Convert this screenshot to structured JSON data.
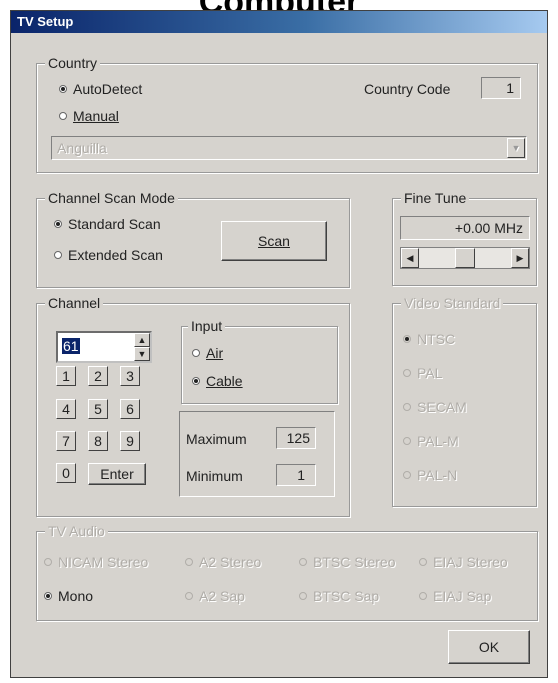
{
  "window": {
    "title": "TV Setup"
  },
  "country": {
    "group_label": "Country",
    "auto_detect_label": "AutoDetect",
    "manual_label": "Manual",
    "country_code_label": "Country Code",
    "country_code_value": "1",
    "selected_country": "Anguilla"
  },
  "scan_mode": {
    "group_label": "Channel Scan Mode",
    "standard_label": "Standard Scan",
    "extended_label": "Extended Scan",
    "scan_button": "Scan"
  },
  "fine_tune": {
    "group_label": "Fine Tune",
    "value": "+0.00 MHz",
    "slider_level": 0.5
  },
  "channel": {
    "group_label": "Channel",
    "current_value": "61",
    "keypad": [
      "1",
      "2",
      "3",
      "4",
      "5",
      "6",
      "7",
      "8",
      "9",
      "0"
    ],
    "enter_label": "Enter",
    "input_group_label": "Input",
    "air_label": "Air",
    "cable_label": "Cable",
    "maximum_label": "Maximum",
    "maximum_value": "125",
    "minimum_label": "Minimum",
    "minimum_value": "1"
  },
  "video_standard": {
    "group_label": "Video Standard",
    "options": [
      "NTSC",
      "PAL",
      "SECAM",
      "PAL-M",
      "PAL-N"
    ]
  },
  "tv_audio": {
    "group_label": "TV Audio",
    "row1": [
      "NICAM Stereo",
      "A2 Stereo",
      "BTSC Stereo",
      "EIAJ Stereo"
    ],
    "mono_label": "Mono",
    "row2": [
      "A2 Sap",
      "BTSC Sap",
      "EIAJ Sap"
    ]
  },
  "footer": {
    "ok_button": "OK"
  },
  "colors": {
    "face": "#d6d3ce",
    "title_start": "#0a246a",
    "title_end": "#a6caf0",
    "selection": "#0a246a"
  }
}
